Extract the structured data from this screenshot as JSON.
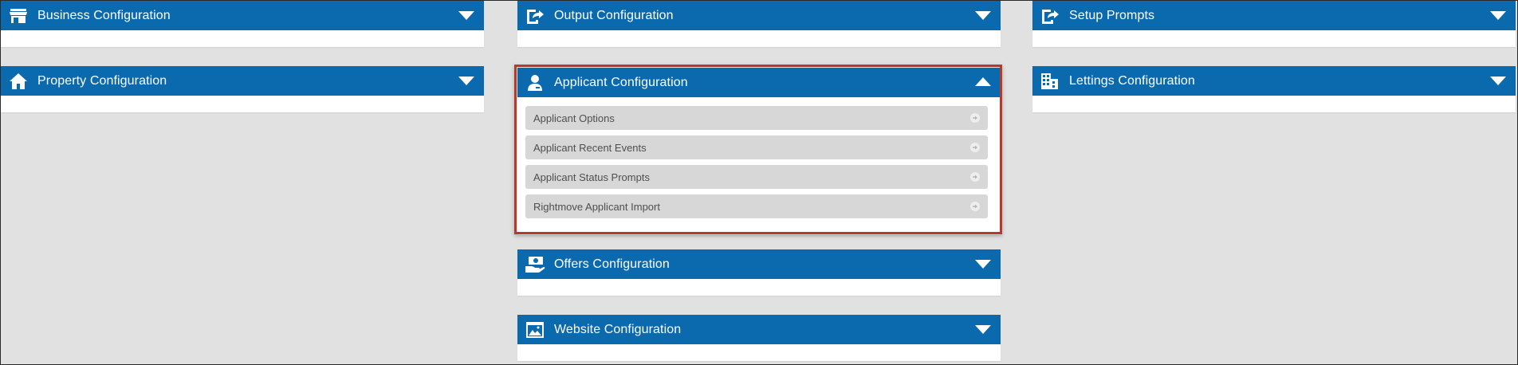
{
  "columns": {
    "left": [
      {
        "title": "Business Configuration",
        "icon": "store-icon",
        "state": "collapsed"
      },
      {
        "title": "Property Configuration",
        "icon": "house-icon",
        "state": "collapsed"
      }
    ],
    "middle": [
      {
        "title": "Output Configuration",
        "icon": "export-icon",
        "state": "collapsed"
      },
      {
        "title": "Applicant Configuration",
        "icon": "user-icon",
        "state": "expanded",
        "items": [
          "Applicant Options",
          "Applicant Recent Events",
          "Applicant Status Prompts",
          "Rightmove Applicant Import"
        ]
      },
      {
        "title": "Offers Configuration",
        "icon": "money-hand-icon",
        "state": "collapsed"
      },
      {
        "title": "Website Configuration",
        "icon": "website-icon",
        "state": "collapsed"
      }
    ],
    "right": [
      {
        "title": "Setup Prompts",
        "icon": "export-icon",
        "state": "collapsed"
      },
      {
        "title": "Lettings Configuration",
        "icon": "building-icon",
        "state": "collapsed"
      }
    ]
  },
  "colors": {
    "header": "#0a6aad",
    "background": "#e1e1e1",
    "highlight_border": "#b53a2a",
    "submenu_item": "#d7d7d7"
  }
}
